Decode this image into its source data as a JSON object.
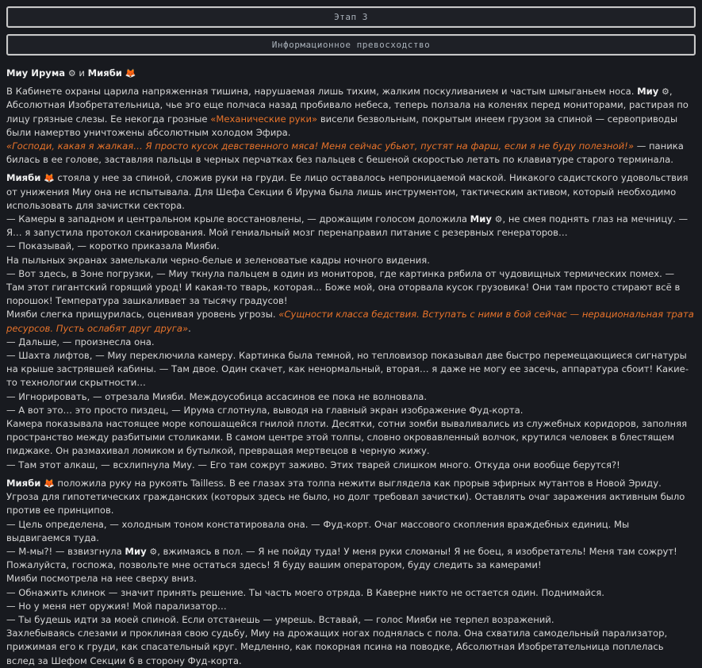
{
  "stage_label": "Этап 3",
  "chapter_label": "Информационное превосходство",
  "characters": {
    "miu": "Миу Ирума",
    "miu_short": "Миу",
    "miyabi": "Мияби"
  },
  "icons": {
    "miu": "gear-icon",
    "miyabi": "fox-icon"
  },
  "text": {
    "and": "и",
    "p1_a": "В Кабинете охраны царила напряженная тишина, нарушаемая лишь тихим, жалким поскуливанием и частым шмыганьем носа.",
    "p1_b": ", Абсолютная Изобретательница, чье эго еще полчаса назад пробивало небеса, теперь ползала на коленях перед мониторами, растирая по лицу грязные слезы. Ее некогда грозные",
    "p1_c": "«Механические руки»",
    "p1_d": "висели безвольным, покрытым инеем грузом за спиной — сервоприводы были намертво уничтожены абсолютным холодом Эфира.",
    "p2_a": "«Господи, какая я жалкая… Я просто кусок девственного мяса! Меня сейчас убьют, пустят на фарш, если я не буду полезной!»",
    "p2_b": "— паника билась в ее голове, заставляя пальцы в черных перчатках без пальцев с бешеной скоростью летать по клавиатуре старого терминала.",
    "p3": "стояла у нее за спиной, сложив руки на груди. Ее лицо оставалось непроницаемой маской. Никакого садистского удовольствия от унижения Миу она не испытывала. Для Шефа Секции 6 Ирума была лишь инструментом, тактическим активом, который необходимо использовать для зачистки сектора.",
    "l1_a": "— Камеры в западном и центральном крыле восстановлены, — дрожащим голосом доложила",
    "l1_b": ", не смея поднять глаз на мечницу. — Я… я запустила протокол сканирования. Мой гениальный мозг перенаправил питание с резервных генераторов…",
    "l2": "— Показывай, — коротко приказала Мияби.",
    "l3": "На пыльных экранах замелькали черно-белые и зеленоватые кадры ночного видения.",
    "l4": "— Вот здесь, в Зоне погрузки, — Миу ткнула пальцем в один из мониторов, где картинка рябила от чудовищных термических помех. — Там этот гигантский горящий урод! И какая-то тварь, которая… Боже мой, она оторвала кусок грузовика! Они там просто стирают всё в порошок! Температура зашкаливает за тысячу градусов!",
    "l5_a": "Мияби слегка прищурилась, оценивая уровень угрозы.",
    "l5_b": "«Сущности класса бедствия. Вступать с ними в бой сейчас — нерациональная трата ресурсов. Пусть ослабят друг друга»",
    "l5_c": ".",
    "l6": "— Дальше, — произнесла она.",
    "l7": "— Шахта лифтов, — Миу переключила камеру. Картинка была темной, но тепловизор показывал две быстро перемещающиеся сигнатуры на крыше застрявшей кабины. — Там двое. Один скачет, как ненормальный, вторая… я даже не могу ее засечь, аппаратура сбоит! Какие-то технологии скрытности…",
    "l8": "— Игнорировать, — отрезала Мияби. Междоусобица ассасинов ее пока не волновала.",
    "l9": "— А вот это… это просто пиздец, — Ирума сглотнула, выводя на главный экран изображение Фуд-корта.",
    "l10": "Камера показывала настоящее море копошащейся гнилой плоти. Десятки, сотни зомби вываливались из служебных коридоров, заполняя пространство между разбитыми столиками. В самом центре этой толпы, словно окровавленный волчок, крутился человек в блестящем пиджаке. Он размахивал ломиком и бутылкой, превращая мертвецов в черную жижу.",
    "l11": "— Там этот алкаш, — всхлипнула Миу. — Его там сожрут заживо. Этих тварей слишком много. Откуда они вообще берутся?!",
    "p4": "положила руку на рукоять Tailless. В ее глазах эта толпа нежити выглядела как прорыв эфирных мутантов в Новой Эриду. Угроза для гипотетических гражданских (которых здесь не было, но долг требовал зачистки). Оставлять очаг заражения активным было против ее принципов.",
    "m1": "— Цель определена, — холодным тоном констатировала она. — Фуд-корт. Очаг массового скопления враждебных единиц. Мы выдвигаемся туда.",
    "m2_a": "— М-мы?! — взвизгнула",
    "m2_b": ", вжимаясь в пол. — Я не пойду туда! У меня руки сломаны! Я не боец, я изобретатель! Меня там сожрут! Пожалуйста, госпожа, позвольте мне остаться здесь! Я буду вашим оператором, буду следить за камерами!",
    "m3": "Мияби посмотрела на нее сверху вниз.",
    "m4": "— Обнажить клинок — значит принять решение. Ты часть моего отряда. В Каверне никто не остается один. Поднимайся.",
    "m5": "— Но у меня нет оружия! Мой парализатор…",
    "m6": "— Ты будешь идти за моей спиной. Если отстанешь — умрешь. Вставай, — голос Мияби не терпел возражений.",
    "m7": "Захлебываясь слезами и проклиная свою судьбу, Миу на дрожащих ногах поднялась с пола. Она схватила самодельный парализатор, прижимая его к груди, как спасательный круг. Медленно, как покорная псина на поводке, Абсолютная Изобретательница поплелась вслед за Шефом Секции 6 в сторону Фуд-корта."
  }
}
